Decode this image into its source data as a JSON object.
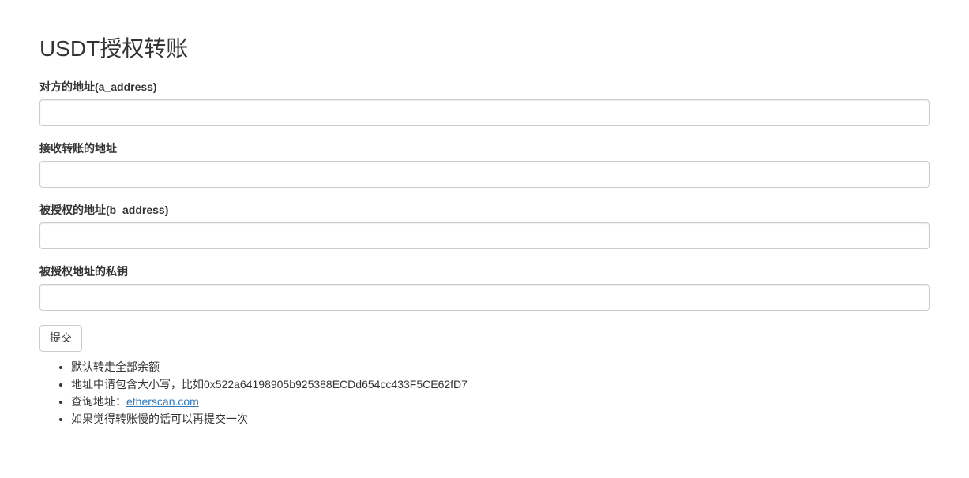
{
  "title": "USDT授权转账",
  "form": {
    "field1": {
      "label": "对方的地址(a_address)",
      "value": ""
    },
    "field2": {
      "label": "接收转账的地址",
      "value": ""
    },
    "field3": {
      "label": "被授权的地址(b_address)",
      "value": ""
    },
    "field4": {
      "label": "被授权地址的私钥",
      "value": ""
    },
    "submit_label": "提交"
  },
  "notes": {
    "item1": "默认转走全部余额",
    "item2": "地址中请包含大小写，比如0x522a64198905b925388ECDd654cc433F5CE62fD7",
    "item3_prefix": "查询地址：",
    "item3_link": "etherscan.com",
    "item4": "如果觉得转账慢的话可以再提交一次"
  }
}
